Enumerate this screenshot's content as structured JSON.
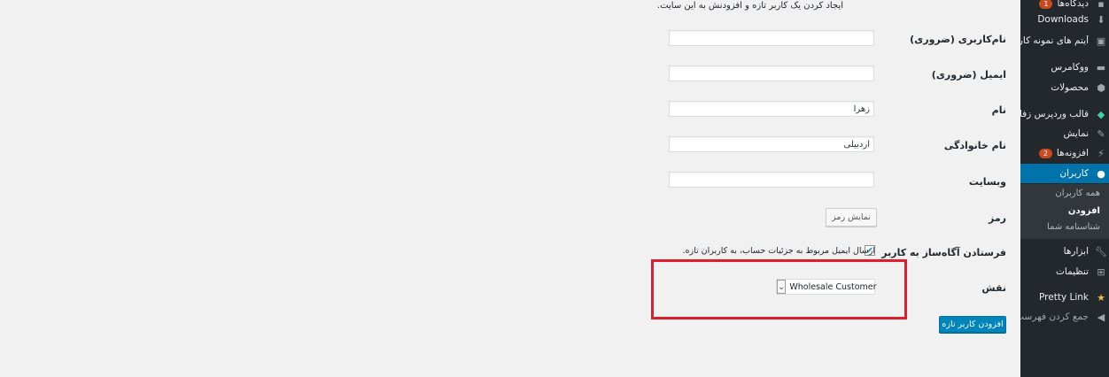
{
  "intro_text": "ایجاد کردن یک کاربر تازه و افزودنش به این سایت.",
  "sidebar": {
    "items": [
      {
        "label": "دیدگاه‌ها",
        "badge": "1",
        "icon": "comment-icon"
      },
      {
        "label": "Downloads",
        "icon": "download-icon"
      },
      {
        "label": "آیتم های نمونه کار",
        "icon": "portfolio-icon"
      },
      {
        "label": "ووکامرس",
        "icon": "woocommerce-icon"
      },
      {
        "label": "محصولات",
        "icon": "product-icon"
      },
      {
        "label": "قالب وردپرس زفایر",
        "icon": "diamond-icon"
      },
      {
        "label": "نمایش",
        "icon": "brush-icon"
      },
      {
        "label": "افزونه‌ها",
        "badge": "2",
        "icon": "plugin-icon"
      },
      {
        "label": "کاربران",
        "icon": "users-icon"
      },
      {
        "label": "ابزارها",
        "icon": "wrench-icon"
      },
      {
        "label": "تنظیمات",
        "icon": "settings-icon"
      },
      {
        "label": "Pretty Link",
        "icon": "star-icon"
      },
      {
        "label": "جمع کردن فهرست",
        "icon": "collapse-icon"
      }
    ],
    "submenu": [
      "همه کاربران",
      "افزودن",
      "شناسنامه شما"
    ]
  },
  "form": {
    "username_label": "نام‌کاربری (ضروری)",
    "username_value": "",
    "email_label": "ایمیل (ضروری)",
    "email_value": "",
    "firstname_label": "نام",
    "firstname_value": "زهرا",
    "lastname_label": "نام خانوادگی",
    "lastname_value": "اردبیلی",
    "website_label": "وبسایت",
    "website_value": "",
    "password_label": "رمز",
    "show_password_button": "نمایش رمز",
    "notify_label": "فرستادن آگاه‌ساز به کاربر",
    "notify_text": "ارسال ایمیل مربوط به جزئیات حساب، به کاربران تازه.",
    "notify_checked": true,
    "role_label": "نقش",
    "role_value": "Wholesale Customer",
    "submit_button": "افزودن کاربر تازه"
  },
  "colors": {
    "sidebar_bg": "#23282d",
    "active_blue": "#0073aa",
    "primary_button": "#0085ba",
    "highlight_red": "#e01e2b",
    "badge": "#ca4a1f"
  }
}
